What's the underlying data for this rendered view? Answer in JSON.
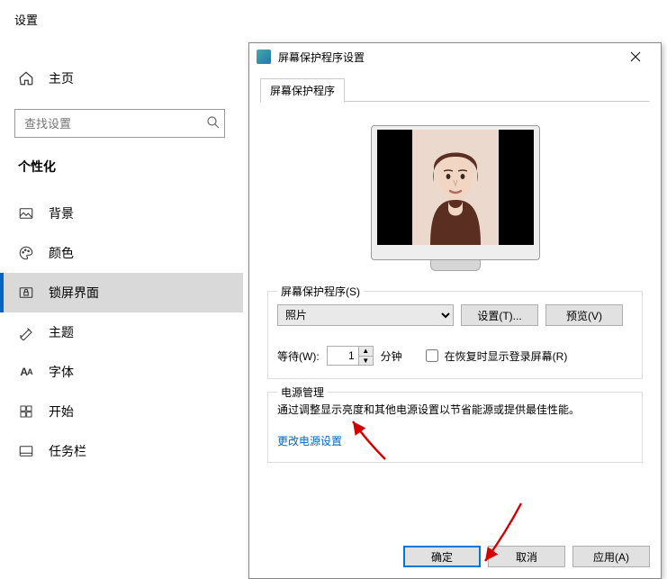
{
  "settings": {
    "title": "设置",
    "home": "主页",
    "search_placeholder": "查找设置",
    "section": "个性化",
    "items": [
      {
        "label": "背景"
      },
      {
        "label": "颜色"
      },
      {
        "label": "锁屏界面"
      },
      {
        "label": "主题"
      },
      {
        "label": "字体"
      },
      {
        "label": "开始"
      },
      {
        "label": "任务栏"
      }
    ]
  },
  "dialog": {
    "title": "屏幕保护程序设置",
    "tab": "屏幕保护程序",
    "group_saver_title": "屏幕保护程序(S)",
    "saver_option": "照片",
    "settings_btn": "设置(T)...",
    "preview_btn": "预览(V)",
    "wait_label": "等待(W):",
    "wait_value": "1",
    "wait_unit": "分钟",
    "resume_label": "在恢复时显示登录屏幕(R)",
    "power_title": "电源管理",
    "power_desc": "通过调整显示亮度和其他电源设置以节省能源或提供最佳性能。",
    "power_link": "更改电源设置",
    "ok": "确定",
    "cancel": "取消",
    "apply": "应用(A)"
  }
}
